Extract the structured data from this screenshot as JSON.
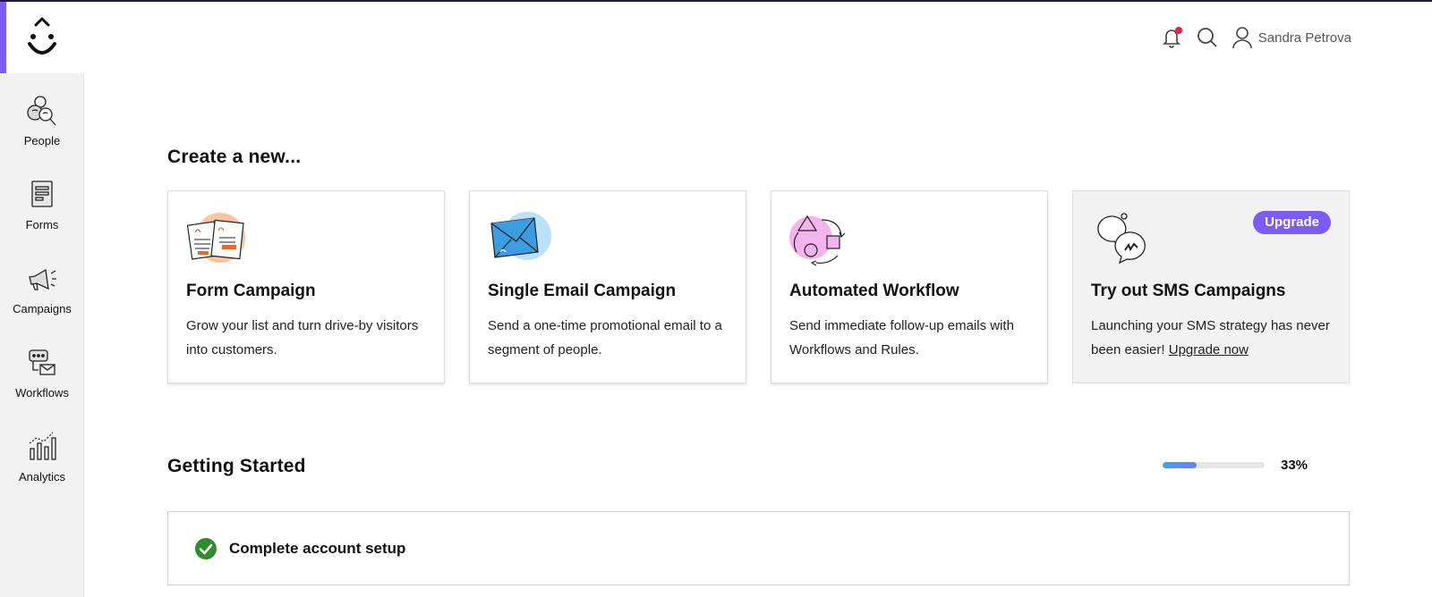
{
  "sidebar": {
    "items": [
      {
        "label": "People",
        "icon": "people-icon"
      },
      {
        "label": "Forms",
        "icon": "forms-icon"
      },
      {
        "label": "Campaigns",
        "icon": "megaphone-icon"
      },
      {
        "label": "Workflows",
        "icon": "workflows-icon"
      },
      {
        "label": "Analytics",
        "icon": "analytics-icon"
      }
    ]
  },
  "header": {
    "user_name": "Sandra Petrova",
    "icons": [
      "bell-icon",
      "search-icon",
      "user-icon"
    ]
  },
  "create": {
    "title": "Create a new...",
    "cards": [
      {
        "title": "Form Campaign",
        "desc": "Grow your list and turn drive-by visitors into customers."
      },
      {
        "title": "Single Email Campaign",
        "desc": "Send a one-time promotional email to a segment of people."
      },
      {
        "title": "Automated Workflow",
        "desc": "Send immediate follow-up emails with Workflows and Rules."
      },
      {
        "title": "Try out SMS Campaigns",
        "desc": "Launching your SMS strategy has never been easier! ",
        "link": "Upgrade now",
        "badge": "Upgrade"
      }
    ]
  },
  "getting_started": {
    "title": "Getting Started",
    "progress_label": "33%",
    "progress_fraction": 0.33,
    "tasks": [
      {
        "label": "Complete account setup",
        "done": true
      }
    ]
  },
  "colors": {
    "accent": "#7b5cf5",
    "check": "#2e8b2e",
    "notification": "#ee1e4a"
  }
}
